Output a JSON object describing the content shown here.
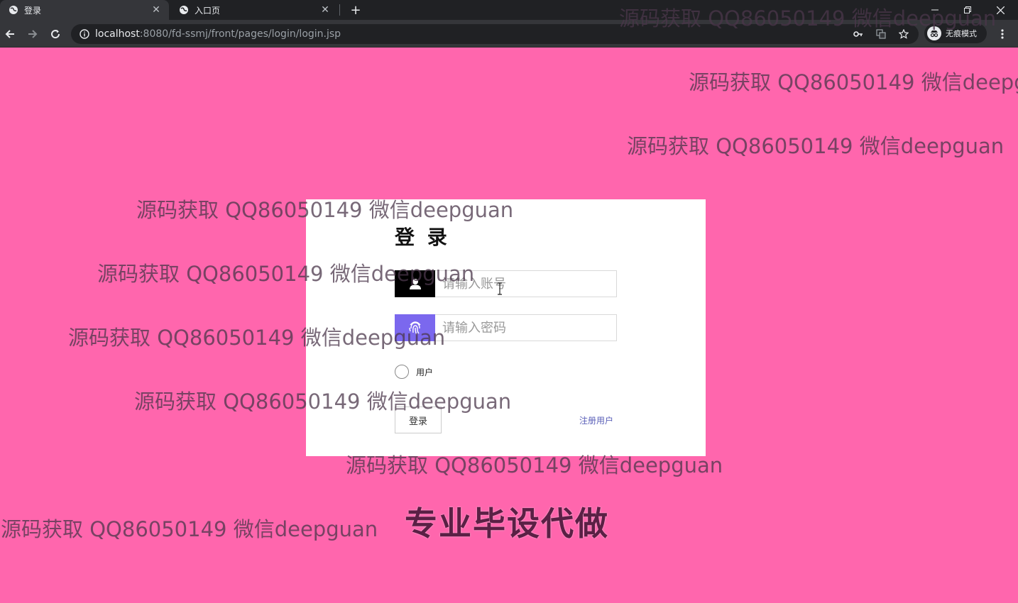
{
  "browser": {
    "tabs": [
      {
        "title": "登录",
        "active": true
      },
      {
        "title": "入口页",
        "active": false
      }
    ],
    "url": {
      "host": "localhost",
      "rest": ":8080/fd-ssmj/front/pages/login/login.jsp"
    },
    "incognito_label": "无痕模式"
  },
  "login": {
    "title": "登 录",
    "username_placeholder": "请输入账号",
    "password_placeholder": "请输入密码",
    "role_option": "用户",
    "login_button": "登录",
    "register_link": "注册用户"
  },
  "watermark": {
    "text": "源码获取 QQ86050149 微信deepguan",
    "promo": "专业毕设代做"
  },
  "colors": {
    "page_background": "#ff66ad",
    "password_addon": "#7b68ee",
    "username_addon": "#000000",
    "link": "#5a5fb8"
  }
}
